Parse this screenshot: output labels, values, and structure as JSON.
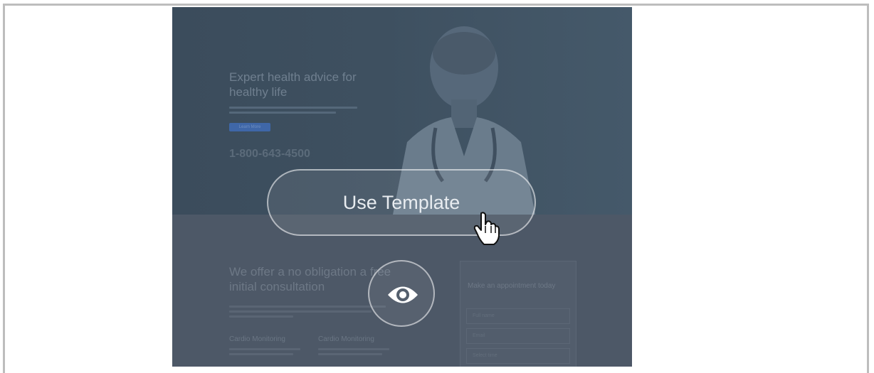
{
  "template_preview": {
    "hero": {
      "title": "Expert health advice for healthy life",
      "cta_label": "Learn More",
      "phone": "1-800-643-4500"
    },
    "offer": {
      "title": "We offer a no obligation a free initial consultation",
      "features": [
        "Cardio Monitoring",
        "Cardio Monitoring"
      ]
    },
    "appointment": {
      "title": "Make an appointment today",
      "fields": [
        "Full name",
        "Email",
        "Select time"
      ]
    }
  },
  "actions": {
    "use_template_label": "Use Template",
    "preview_icon": "eye-icon"
  },
  "cursor": "hand-pointer-icon"
}
